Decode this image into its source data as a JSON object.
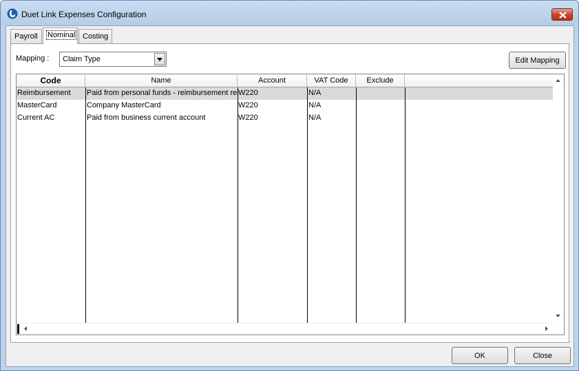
{
  "window": {
    "title": "Duet Link Expenses Configuration"
  },
  "tabs": [
    {
      "label": "Payroll",
      "active": false
    },
    {
      "label": "Nominal",
      "active": true
    },
    {
      "label": "Costing",
      "active": false
    }
  ],
  "mapping": {
    "label": "Mapping :",
    "selected": "Claim Type",
    "edit_button": "Edit Mapping"
  },
  "grid": {
    "columns": [
      "Code",
      "Name",
      "Account",
      "VAT Code",
      "Exclude"
    ],
    "rows": [
      {
        "code": "Reimbursement",
        "name": "Paid from personal funds - reimbursement requ",
        "account": "W220",
        "vat": "N/A",
        "exclude": ""
      },
      {
        "code": "MasterCard",
        "name": "Company MasterCard",
        "account": "W220",
        "vat": "N/A",
        "exclude": ""
      },
      {
        "code": "Current AC",
        "name": "Paid from business current account",
        "account": "W220",
        "vat": "N/A",
        "exclude": ""
      }
    ],
    "selected_row": 0
  },
  "buttons": {
    "ok": "OK",
    "close": "Close"
  },
  "colors": {
    "selected_row": "#dadada",
    "window_frame": "#bcd3ea",
    "close_button": "#c84a30"
  }
}
